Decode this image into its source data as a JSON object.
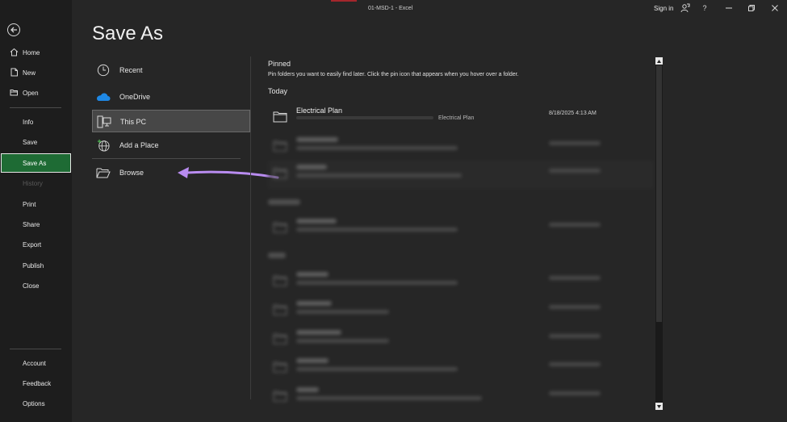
{
  "window": {
    "title": "01-MSD-1  -  Excel",
    "sign_in": "Sign in"
  },
  "sidebar": {
    "items": [
      {
        "label": "Home",
        "icon": "home-icon"
      },
      {
        "label": "New",
        "icon": "new-document-icon"
      },
      {
        "label": "Open",
        "icon": "open-folder-icon"
      },
      {
        "label": "Info"
      },
      {
        "label": "Save"
      },
      {
        "label": "Save As",
        "active": true
      },
      {
        "label": "History",
        "disabled": true
      },
      {
        "label": "Print"
      },
      {
        "label": "Share"
      },
      {
        "label": "Export"
      },
      {
        "label": "Publish"
      },
      {
        "label": "Close"
      }
    ],
    "bottom": [
      {
        "label": "Account"
      },
      {
        "label": "Feedback"
      },
      {
        "label": "Options"
      }
    ]
  },
  "page": {
    "title": "Save As"
  },
  "locations": [
    {
      "label": "Recent",
      "icon": "clock-icon"
    },
    {
      "label": "OneDrive",
      "icon": "cloud-icon"
    },
    {
      "label": "This PC",
      "icon": "computer-icon",
      "selected": true
    },
    {
      "label": "Add a Place",
      "icon": "globe-add-icon"
    },
    {
      "label": "Browse",
      "icon": "browse-folder-icon"
    }
  ],
  "pinned": {
    "heading": "Pinned",
    "description": "Pin folders you want to easily find later. Click the pin icon that appears when you hover over a folder.",
    "today_heading": "Today",
    "folders": [
      {
        "name": "Electrical Plan",
        "path": "Electrical Plan",
        "date": "8/18/2025 4:13 AM"
      }
    ]
  },
  "colors": {
    "accent": "#1e6b34",
    "background": "#262626",
    "sidebar": "#1d1d1d",
    "annotation_arrow": "#b98cf0"
  }
}
